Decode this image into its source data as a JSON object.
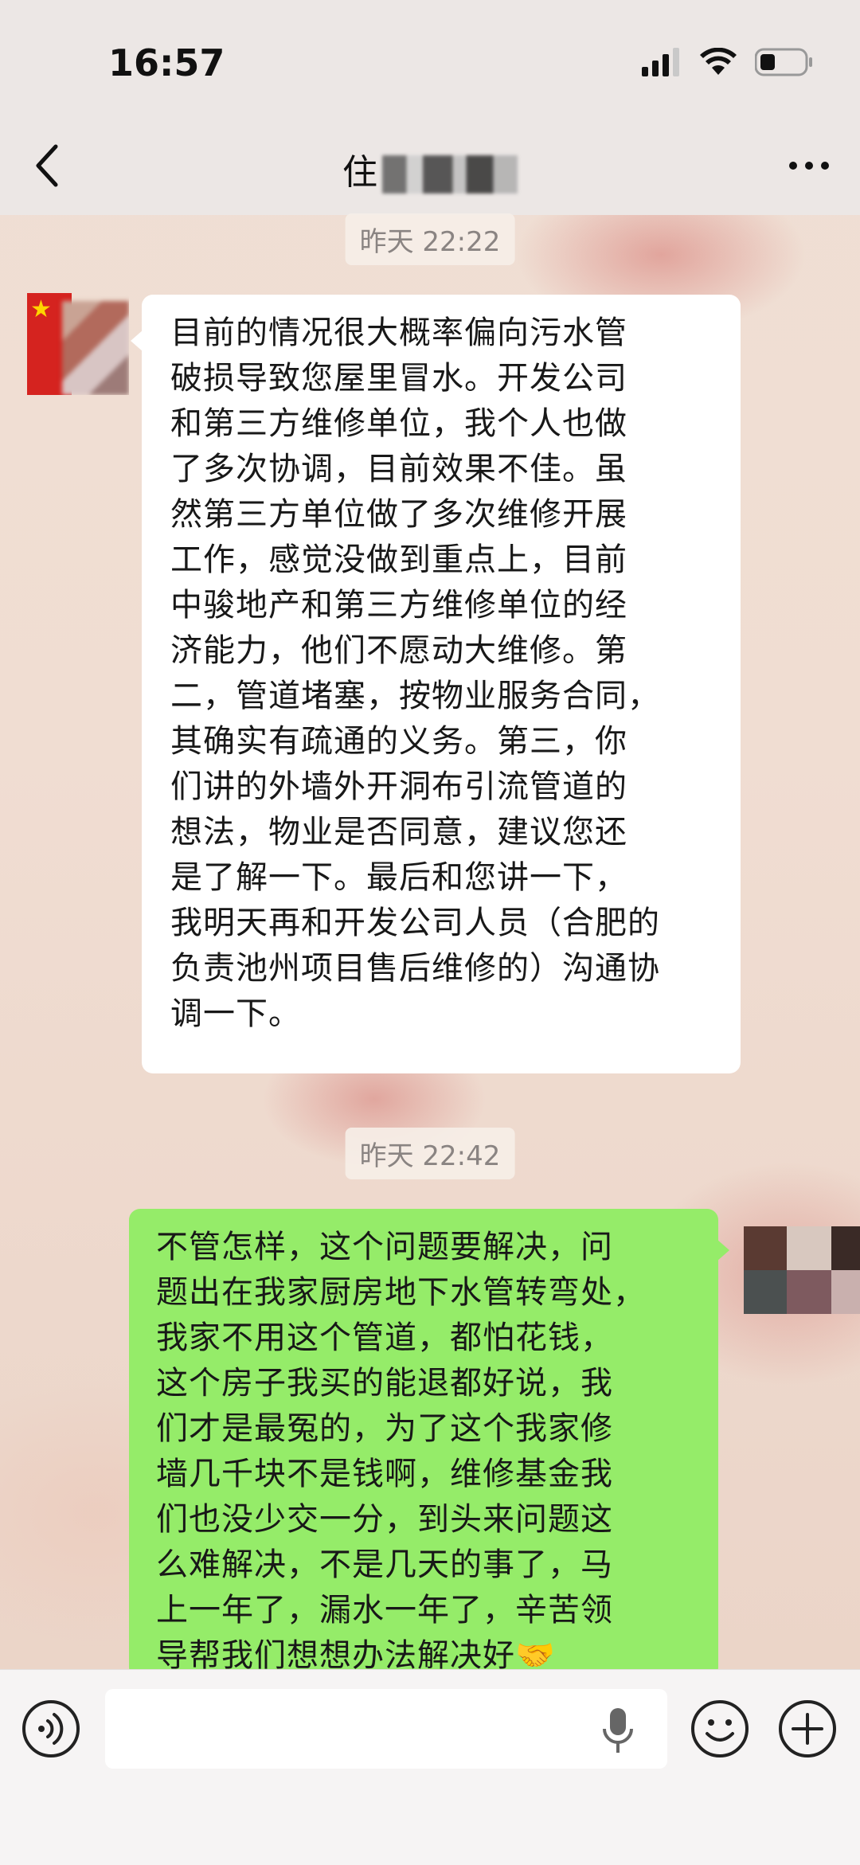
{
  "status_bar": {
    "time": "16:57"
  },
  "header": {
    "title_visible": "住"
  },
  "messages": [
    {
      "timestamp": "昨天 22:22",
      "direction": "incoming",
      "lines": [
        "目前的情况很大概率偏向污水管",
        "破损导致您屋里冒水。开发公司",
        "和第三方维修单位，我个人也做",
        "了多次协调，目前效果不佳。虽",
        "然第三方单位做了多次维修开展",
        "工作，感觉没做到重点上，目前",
        "中骏地产和第三方维修单位的经",
        "济能力，他们不愿动大维修。第",
        "二，管道堵塞，按物业服务合同，",
        "其确实有疏通的义务。第三，你",
        "们讲的外墙外开洞布引流管道的",
        "想法，物业是否同意，建议您还",
        "是了解一下。最后和您讲一下，",
        "我明天再和开发公司人员（合肥的",
        "负责池州项目售后维修的）沟通协",
        "调一下。"
      ]
    },
    {
      "timestamp": "昨天 22:42",
      "direction": "outgoing",
      "lines": [
        "不管怎样，这个问题要解决，问",
        "题出在我家厨房地下水管转弯处，",
        "我家不用这个管道，都怕花钱，",
        "这个房子我买的能退都好说，我",
        "们才是最冤的，为了这个我家修",
        "墙几千块不是钱啊，维修基金我",
        "们也没少交一分，到头来问题这",
        "么难解决，不是几天的事了，马",
        "上一年了，漏水一年了，辛苦领",
        "导帮我们想想办法解决好🤝"
      ]
    }
  ],
  "input": {
    "value": "",
    "placeholder": ""
  },
  "icons": {
    "back": "chevron-left-icon",
    "more": "more-horizontal-icon",
    "voice": "voice-icon",
    "mic": "microphone-icon",
    "emoji": "emoji-icon",
    "plus": "plus-icon"
  },
  "colors": {
    "outgoing_bubble": "#95ec69",
    "incoming_bubble": "#ffffff",
    "timestamp_text": "#8a8482"
  }
}
